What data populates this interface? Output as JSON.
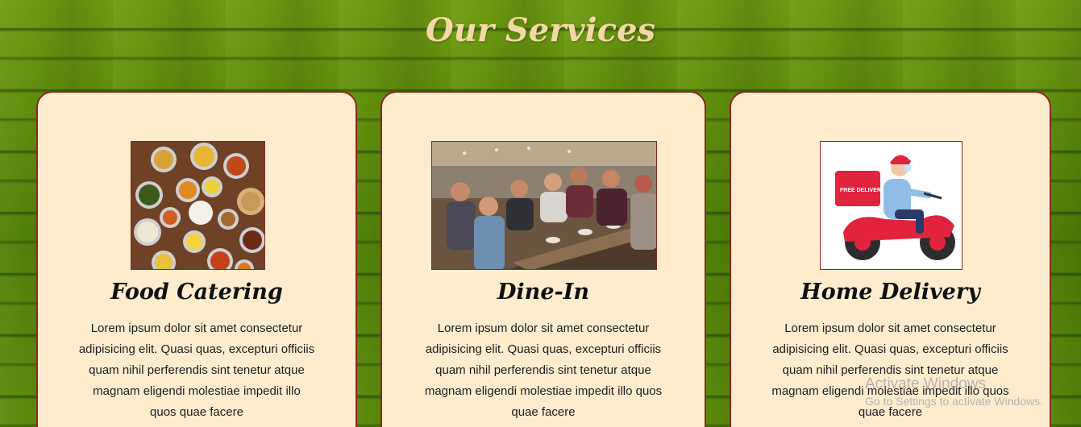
{
  "section": {
    "title": "Our Services"
  },
  "cards": [
    {
      "title": "Food Catering",
      "image": "food-platter-image",
      "text": "Lorem ipsum dolor sit amet consectetur adipisicing elit. Quasi quas, excepturi officiis quam nihil perferendis sint tenetur atque magnam eligendi molestiae impedit illo quos quae facere"
    },
    {
      "title": "Dine-In",
      "image": "friends-dining-image",
      "text": "Lorem ipsum dolor sit amet consectetur adipisicing elit. Quasi quas, excepturi officiis quam nihil perferendis sint tenetur atque magnam eligendi molestiae impedit illo quos quae facere"
    },
    {
      "title": "Home Delivery",
      "image": "scooter-delivery-image",
      "delivery_box_label": "FREE DELIVERY",
      "text": "Lorem ipsum dolor sit amet consectetur adipisicing elit. Quasi quas, excepturi officiis quam nihil perferendis sint tenetur atque magnam eligendi molestiae impedit illo quos quae facere"
    }
  ],
  "watermark": {
    "line1": "Activate Windows",
    "line2": "Go to Settings to activate Windows."
  },
  "colors": {
    "card_bg": "#ffecce",
    "card_border": "#8b2a1a",
    "title_color": "#f3d9a4",
    "background": "#5f8e0c"
  }
}
